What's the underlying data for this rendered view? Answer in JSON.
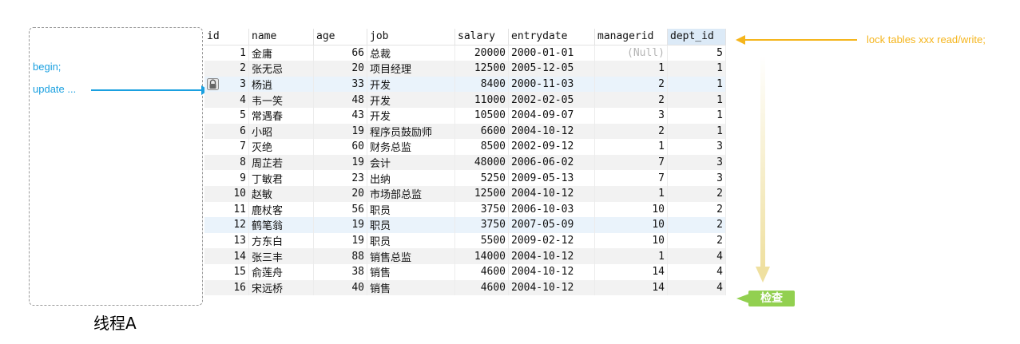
{
  "thread": {
    "label": "线程A",
    "begin": "begin;",
    "update": "update ..."
  },
  "annotations": {
    "lock": "lock tables xxx read/write;",
    "check": "检查"
  },
  "colors": {
    "blue": "#1aa0e0",
    "orange": "#f5b51c",
    "green": "#92d050",
    "selected_header": "#dceaf7"
  },
  "grid": {
    "columns": [
      "id",
      "name",
      "age",
      "job",
      "salary",
      "entrydate",
      "managerid",
      "dept_id"
    ],
    "selected_column": "dept_id",
    "locked_row_icon": "lock-icon",
    "rows": [
      {
        "id": "1",
        "name": "金庸",
        "age": "66",
        "job": "总裁",
        "salary": "20000",
        "entrydate": "2000-01-01",
        "managerid": "(Null)",
        "dept_id": "5"
      },
      {
        "id": "2",
        "name": "张无忌",
        "age": "20",
        "job": "项目经理",
        "salary": "12500",
        "entrydate": "2005-12-05",
        "managerid": "1",
        "dept_id": "1"
      },
      {
        "id": "3",
        "name": "杨逍",
        "age": "33",
        "job": "开发",
        "salary": "8400",
        "entrydate": "2000-11-03",
        "managerid": "2",
        "dept_id": "1"
      },
      {
        "id": "4",
        "name": "韦一笑",
        "age": "48",
        "job": "开发",
        "salary": "11000",
        "entrydate": "2002-02-05",
        "managerid": "2",
        "dept_id": "1"
      },
      {
        "id": "5",
        "name": "常遇春",
        "age": "43",
        "job": "开发",
        "salary": "10500",
        "entrydate": "2004-09-07",
        "managerid": "3",
        "dept_id": "1"
      },
      {
        "id": "6",
        "name": "小昭",
        "age": "19",
        "job": "程序员鼓励师",
        "salary": "6600",
        "entrydate": "2004-10-12",
        "managerid": "2",
        "dept_id": "1"
      },
      {
        "id": "7",
        "name": "灭绝",
        "age": "60",
        "job": "财务总监",
        "salary": "8500",
        "entrydate": "2002-09-12",
        "managerid": "1",
        "dept_id": "3"
      },
      {
        "id": "8",
        "name": "周芷若",
        "age": "19",
        "job": "会计",
        "salary": "48000",
        "entrydate": "2006-06-02",
        "managerid": "7",
        "dept_id": "3"
      },
      {
        "id": "9",
        "name": "丁敏君",
        "age": "23",
        "job": "出纳",
        "salary": "5250",
        "entrydate": "2009-05-13",
        "managerid": "7",
        "dept_id": "3"
      },
      {
        "id": "10",
        "name": "赵敏",
        "age": "20",
        "job": "市场部总监",
        "salary": "12500",
        "entrydate": "2004-10-12",
        "managerid": "1",
        "dept_id": "2"
      },
      {
        "id": "11",
        "name": "鹿杖客",
        "age": "56",
        "job": "职员",
        "salary": "3750",
        "entrydate": "2006-10-03",
        "managerid": "10",
        "dept_id": "2"
      },
      {
        "id": "12",
        "name": "鹤笔翁",
        "age": "19",
        "job": "职员",
        "salary": "3750",
        "entrydate": "2007-05-09",
        "managerid": "10",
        "dept_id": "2"
      },
      {
        "id": "13",
        "name": "方东白",
        "age": "19",
        "job": "职员",
        "salary": "5500",
        "entrydate": "2009-02-12",
        "managerid": "10",
        "dept_id": "2"
      },
      {
        "id": "14",
        "name": "张三丰",
        "age": "88",
        "job": "销售总监",
        "salary": "14000",
        "entrydate": "2004-10-12",
        "managerid": "1",
        "dept_id": "4"
      },
      {
        "id": "15",
        "name": "俞莲舟",
        "age": "38",
        "job": "销售",
        "salary": "4600",
        "entrydate": "2004-10-12",
        "managerid": "14",
        "dept_id": "4"
      },
      {
        "id": "16",
        "name": "宋远桥",
        "age": "40",
        "job": "销售",
        "salary": "4600",
        "entrydate": "2004-10-12",
        "managerid": "14",
        "dept_id": "4"
      }
    ]
  }
}
